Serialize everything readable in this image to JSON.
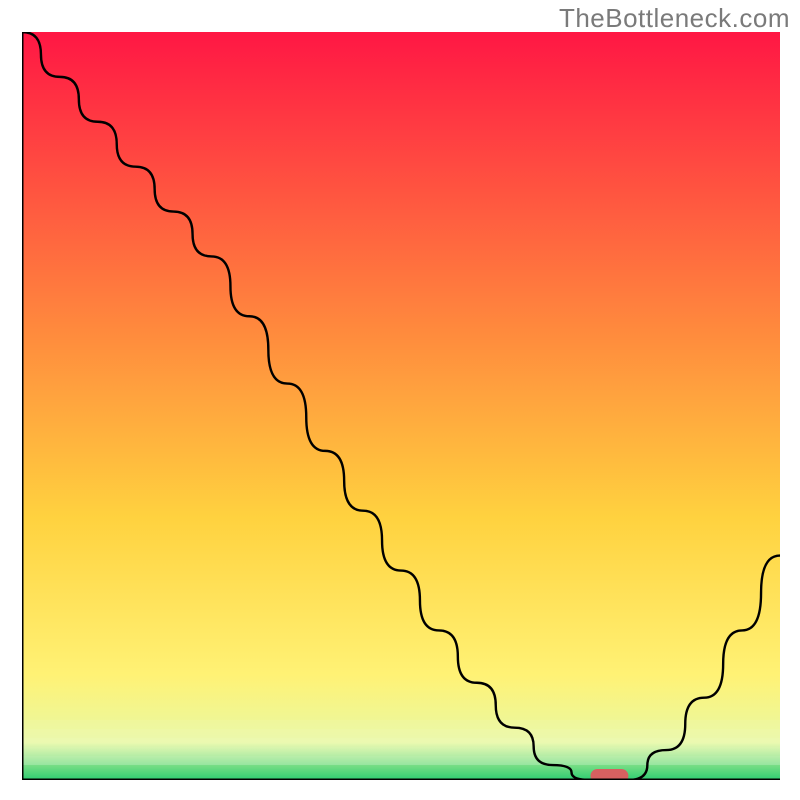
{
  "watermark": "TheBottleneck.com",
  "chart_data": {
    "type": "line",
    "title": "",
    "xlabel": "",
    "ylabel": "",
    "xlim": [
      0,
      100
    ],
    "ylim": [
      0,
      100
    ],
    "x": [
      0,
      5,
      10,
      15,
      20,
      25,
      30,
      35,
      40,
      45,
      50,
      55,
      60,
      65,
      70,
      75,
      80,
      85,
      90,
      95,
      100
    ],
    "values": [
      100,
      94,
      88,
      82,
      76,
      70,
      62,
      53,
      44,
      36,
      28,
      20,
      13,
      7,
      2,
      0,
      0,
      4,
      11,
      20,
      30
    ],
    "marker": {
      "x_start": 75,
      "x_end": 80,
      "y": 0,
      "color": "#d66060"
    },
    "background_gradient": {
      "stops": [
        {
          "offset": 0,
          "color": "#ff1744"
        },
        {
          "offset": 40,
          "color": "#ff8a3d"
        },
        {
          "offset": 65,
          "color": "#ffd23f"
        },
        {
          "offset": 86,
          "color": "#fff275"
        },
        {
          "offset": 95,
          "color": "#e8f9a4"
        },
        {
          "offset": 100,
          "color": "#2ecc71"
        }
      ]
    },
    "line_color": "#000000",
    "axis_color": "#000000"
  }
}
